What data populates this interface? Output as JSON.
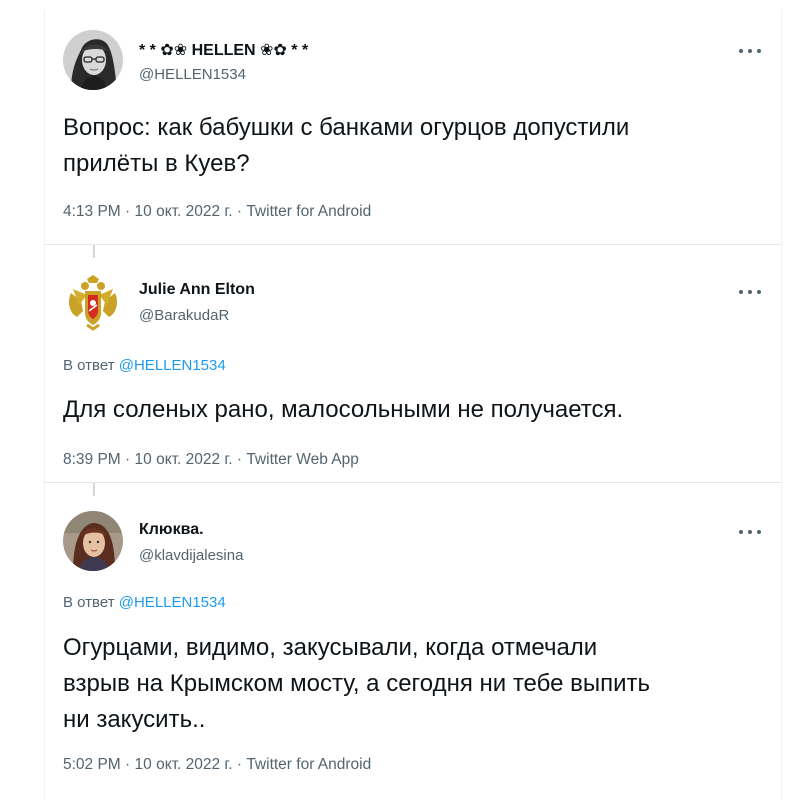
{
  "tweets": [
    {
      "name": "* * ✿❀ HELLEN ❀✿ * *",
      "handle": "@HELLEN1534",
      "text_lines": [
        "Вопрос: как бабушки с банками огурцов допустили",
        "прилёты в Куев?"
      ],
      "time": "4:13 PM",
      "date": "10 окт. 2022 г.",
      "source": "Twitter for Android"
    },
    {
      "name": "Julie Ann Elton",
      "handle": "@BarakudaR",
      "reply_prefix": "В ответ",
      "reply_to": "@HELLEN1534",
      "text_lines": [
        "Для соленых рано, малосольными не получается."
      ],
      "time": "8:39 PM",
      "date": "10 окт. 2022 г.",
      "source": "Twitter Web App"
    },
    {
      "name": "Клюква.",
      "handle": "@klavdijalesina",
      "reply_prefix": "В ответ",
      "reply_to": "@HELLEN1534",
      "text_lines": [
        "Огурцами, видимо, закусывали, когда отмечали",
        "взрыв на Крымском мосту, а сегодня ни тебе выпить",
        "ни закусить.."
      ],
      "time": "5:02 PM",
      "date": "10 окт. 2022 г.",
      "source": "Twitter for Android"
    }
  ],
  "separator": "·",
  "colors": {
    "text": "#0f1419",
    "secondary": "#536471",
    "link": "#1d9bf0",
    "divider": "#e4e8ea"
  },
  "icons": {
    "more": "more-horizontal-icon",
    "avatar2": "double-headed-eagle-coat-of-arms"
  }
}
